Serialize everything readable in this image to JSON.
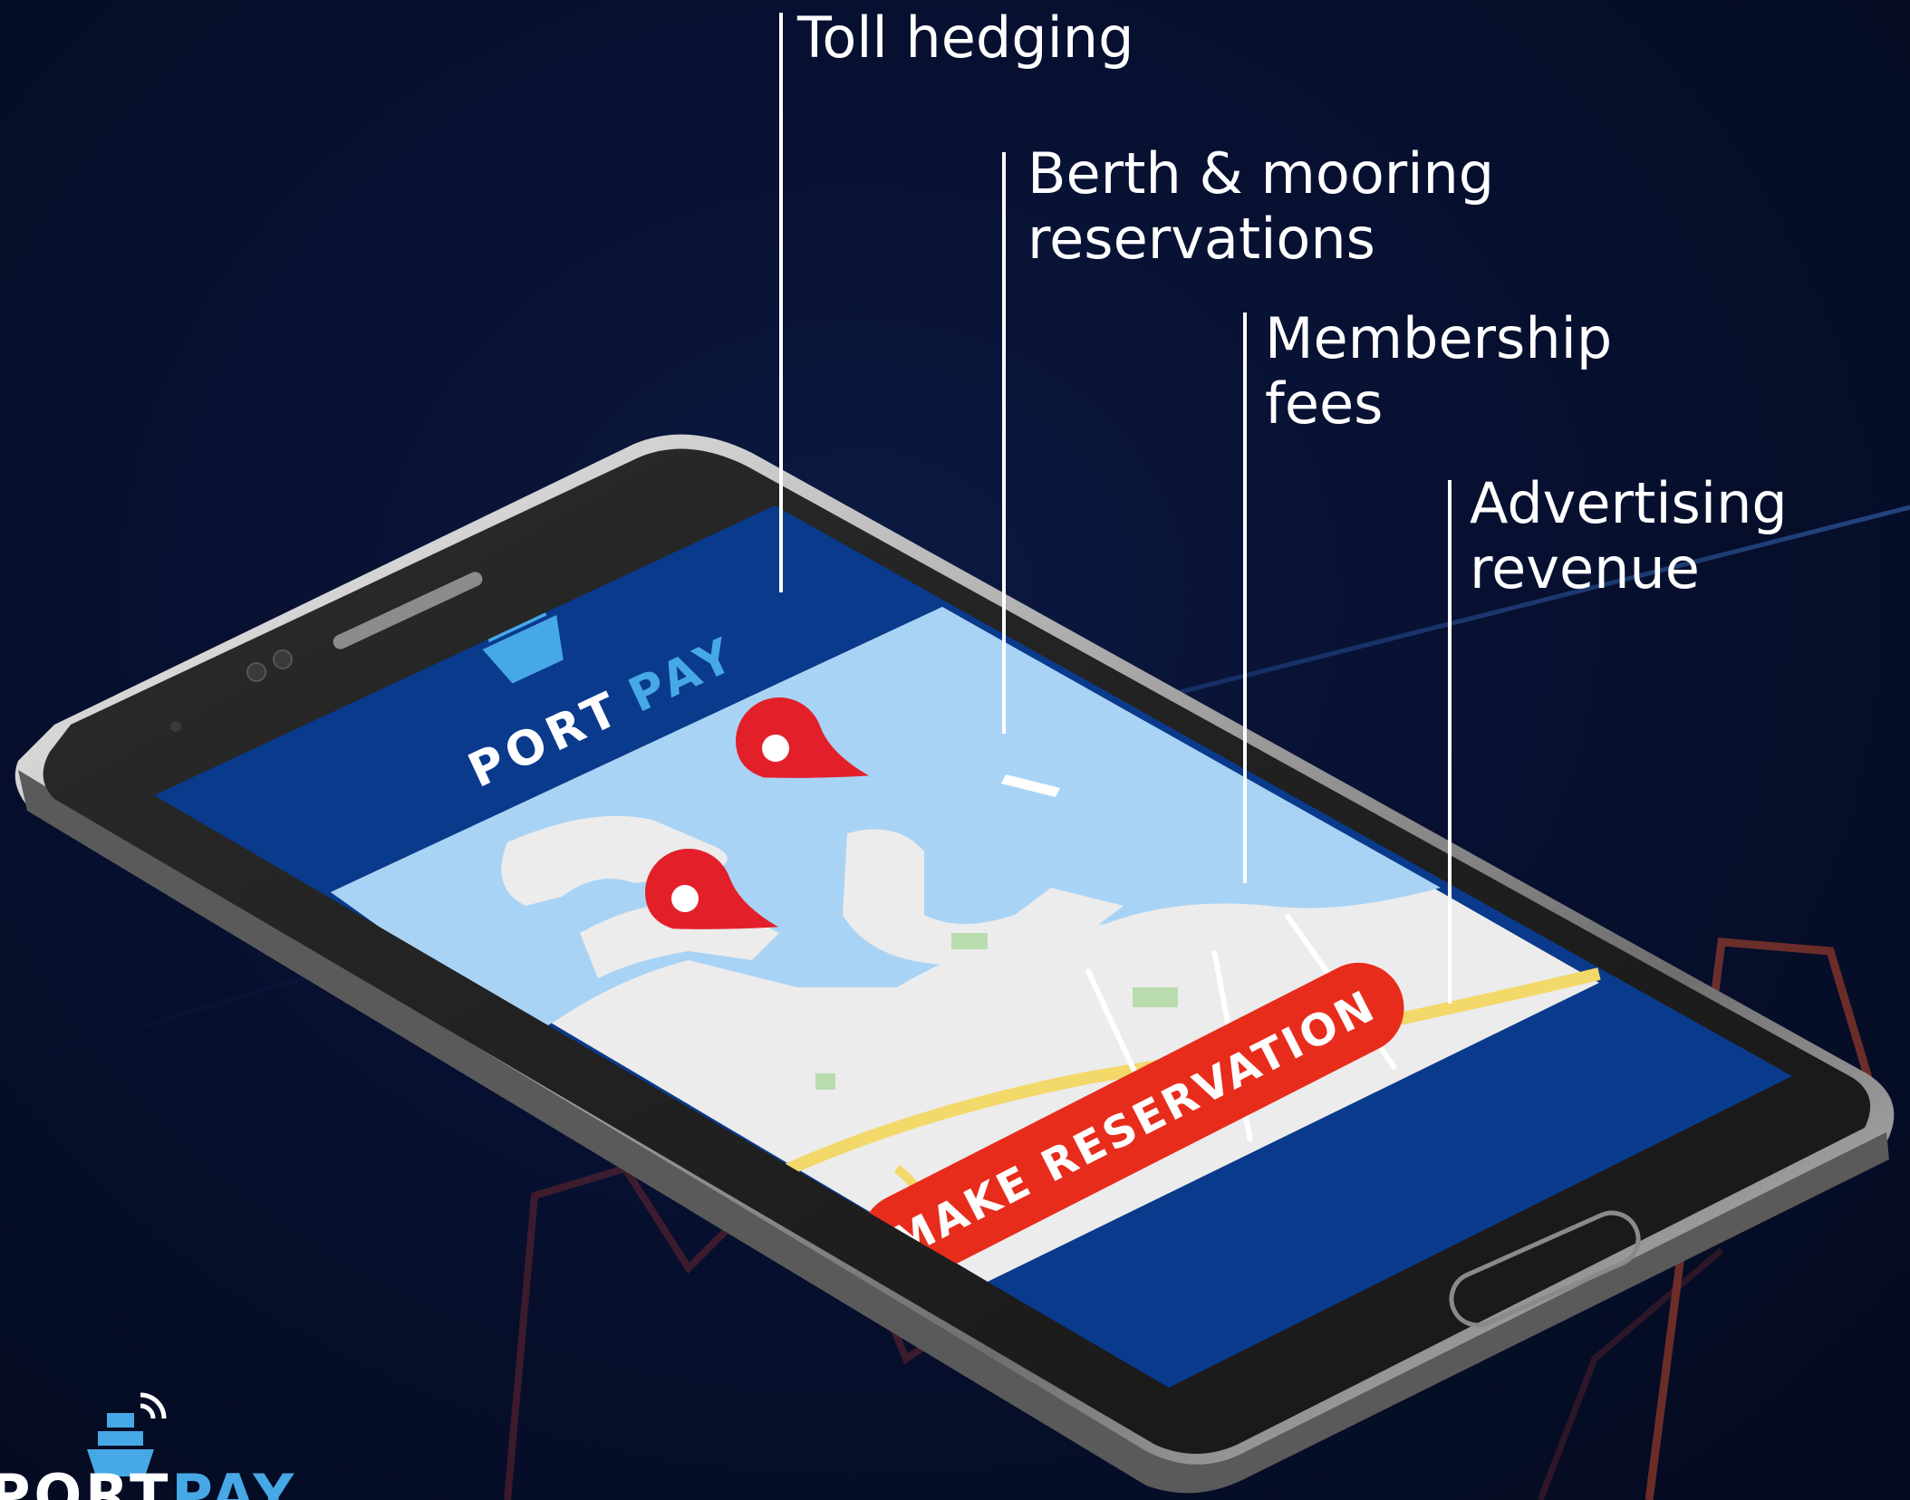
{
  "callouts": [
    {
      "lines": [
        "Toll hedging"
      ]
    },
    {
      "lines": [
        "Berth & mooring",
        "reservations"
      ]
    },
    {
      "lines": [
        "Membership",
        "fees"
      ]
    },
    {
      "lines": [
        "Advertising",
        "revenue"
      ]
    }
  ],
  "app": {
    "brand_part1": "PORT",
    "brand_part2": "PAY",
    "cta_label": "MAKE RESERVATION"
  },
  "corner_brand": {
    "part1": "PORT",
    "part2": "PAY"
  },
  "colors": {
    "background": "#050b24",
    "app_header": "#0a3a8c",
    "map_water": "#a9d3f5",
    "map_land": "#ececec",
    "pin": "#e3202a",
    "cta": "#e82c1c",
    "brand_accent": "#47a8e6",
    "chart_accent": "#c0492b"
  },
  "icons": [
    "ship-logo-icon",
    "map-pin-icon",
    "wifi-signal-icon"
  ]
}
